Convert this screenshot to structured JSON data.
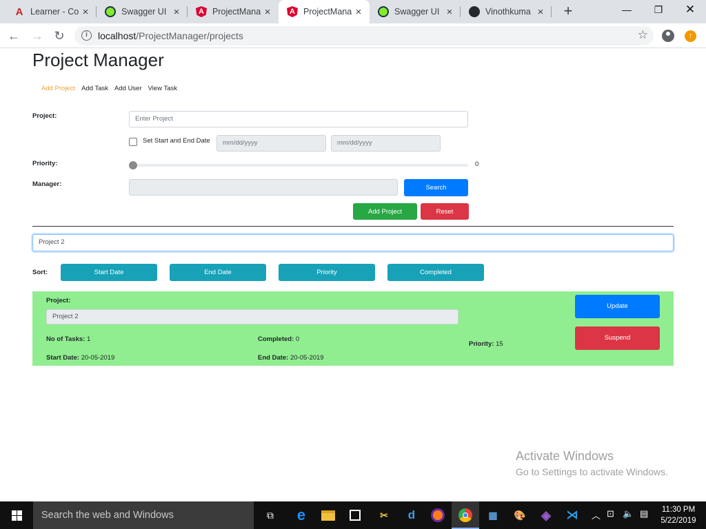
{
  "browser": {
    "tabs": [
      {
        "title": "Learner - Co",
        "icon": "learner-icon",
        "active": false
      },
      {
        "title": "Swagger UI",
        "icon": "swagger-icon",
        "active": false
      },
      {
        "title": "ProjectMana",
        "icon": "angular-icon",
        "active": false
      },
      {
        "title": "ProjectMana",
        "icon": "angular-icon",
        "active": true
      },
      {
        "title": "Swagger UI",
        "icon": "swagger-icon",
        "active": false
      },
      {
        "title": "Vinothkuma",
        "icon": "github-icon",
        "active": false
      }
    ],
    "url_host": "localhost",
    "url_path": "/ProjectManager/projects"
  },
  "app": {
    "title": "Project Manager",
    "nav": [
      {
        "label": "Add Project",
        "active": true
      },
      {
        "label": "Add Task",
        "active": false
      },
      {
        "label": "Add User",
        "active": false
      },
      {
        "label": "View Task",
        "active": false
      }
    ]
  },
  "form": {
    "project_label": "Project:",
    "project_placeholder": "Enter Project",
    "set_dates_label": "Set Start and End Date",
    "start_date_placeholder": "mm/dd/yyyy",
    "end_date_placeholder": "mm/dd/yyyy",
    "priority_label": "Priority:",
    "priority_value": "0",
    "manager_label": "Manager:",
    "search_button": "Search",
    "add_button": "Add Project",
    "reset_button": "Reset"
  },
  "filter": {
    "search_value": "Project 2",
    "sort_label": "Sort:",
    "sort_buttons": [
      "Start Date",
      "End Date",
      "Priority",
      "Completed"
    ]
  },
  "project_card": {
    "project_label": "Project:",
    "project_name": "Project 2",
    "tasks_label": "No of Tasks:",
    "tasks_value": "1",
    "completed_label": "Completed:",
    "completed_value": "0",
    "priority_label": "Priority:",
    "priority_value": "15",
    "start_label": "Start Date:",
    "start_value": "20-05-2019",
    "end_label": "End Date:",
    "end_value": "20-05-2019",
    "update_button": "Update",
    "suspend_button": "Suspend",
    "background": "#90ee90"
  },
  "watermark": {
    "line1": "Activate Windows",
    "line2": "Go to Settings to activate Windows."
  },
  "taskbar": {
    "search_text": "Search the web and Windows",
    "time": "11:30 PM",
    "date": "5/22/2019"
  },
  "colors": {
    "nav_active": "#e8a33d",
    "primary": "#007bff",
    "success": "#28a745",
    "danger": "#dc3545",
    "info": "#17a2b8"
  }
}
